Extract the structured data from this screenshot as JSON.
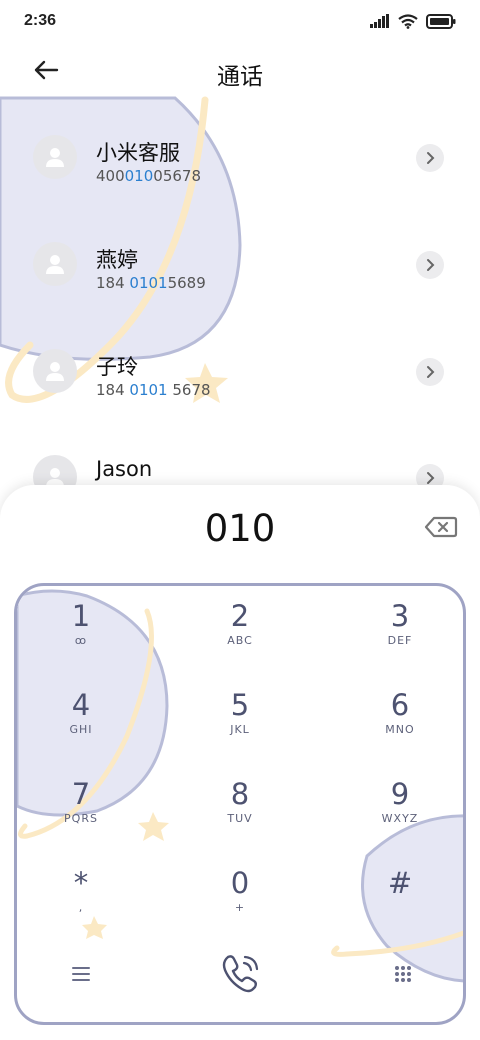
{
  "status": {
    "time": "2:36"
  },
  "header": {
    "title": "通话"
  },
  "contacts": [
    {
      "name": "小米客服",
      "num_pre": "400",
      "num_hl": "010",
      "num_post": "05678"
    },
    {
      "name": "燕婷",
      "num_pre": "184 ",
      "num_hl": "0101",
      "num_post": "5689"
    },
    {
      "name": "子玲",
      "num_pre": "184 ",
      "num_hl": "0101",
      "num_post": " 5678"
    },
    {
      "name": "Jason",
      "num_pre": "",
      "num_hl": "",
      "num_post": ""
    }
  ],
  "dialer": {
    "entered": "010",
    "keys": [
      {
        "digit": "1",
        "letters": "ꝏ"
      },
      {
        "digit": "2",
        "letters": "ABC"
      },
      {
        "digit": "3",
        "letters": "DEF"
      },
      {
        "digit": "4",
        "letters": "GHI"
      },
      {
        "digit": "5",
        "letters": "JKL"
      },
      {
        "digit": "6",
        "letters": "MNO"
      },
      {
        "digit": "7",
        "letters": "PQRS"
      },
      {
        "digit": "8",
        "letters": "TUV"
      },
      {
        "digit": "9",
        "letters": "WXYZ"
      },
      {
        "digit": "*",
        "letters": ","
      },
      {
        "digit": "0",
        "letters": "+"
      },
      {
        "digit": "#",
        "letters": ""
      }
    ]
  },
  "icons": {
    "back": "arrow-left-icon",
    "delete": "backspace-icon",
    "menu": "menu-icon",
    "call": "phone-call-icon",
    "keypad": "keypad-grid-icon"
  },
  "colors": {
    "accent": "#2b7fcf",
    "planet_fill": "#e6e7f4",
    "planet_stroke": "#b8bcd8",
    "ring": "#fbe9c4",
    "key_text": "#4d5270"
  }
}
